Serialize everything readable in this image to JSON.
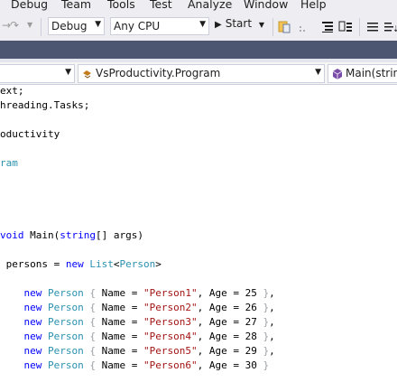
{
  "menu": [
    "Debug",
    "Team",
    "Tools",
    "Test",
    "Analyze",
    "Window",
    "Help"
  ],
  "toolbar": {
    "configuration": "Debug",
    "platform": "Any CPU",
    "start_label": "Start"
  },
  "navbar": {
    "type_label": "VsProductivity.Program",
    "member_label": "Main(strin"
  },
  "code": {
    "l1": "ext;",
    "l2": "hreading.Tasks;",
    "l3": "oductivity",
    "l4": "ram",
    "main_kw": "void",
    "main_name": " Main(",
    "main_type": "string",
    "main_rest": "[] args)",
    "list_pre": " persons = ",
    "list_new": "new",
    "list_type": "List",
    "list_lt": "<",
    "list_arg": "Person",
    "list_gt": ">",
    "new_kw": "new",
    "person_type": "Person",
    "open_brace": "{",
    "name_eq": " Name = ",
    "age_eq": ", Age = ",
    "close_brace": "}",
    "rows": [
      {
        "name": "\"Person1\"",
        "age": "25",
        "end": ","
      },
      {
        "name": "\"Person2\"",
        "age": "26",
        "end": ","
      },
      {
        "name": "\"Person3\"",
        "age": "27",
        "end": ","
      },
      {
        "name": "\"Person4\"",
        "age": "28",
        "end": ","
      },
      {
        "name": "\"Person5\"",
        "age": "29",
        "end": ","
      },
      {
        "name": "\"Person6\"",
        "age": "30",
        "end": ""
      }
    ]
  }
}
